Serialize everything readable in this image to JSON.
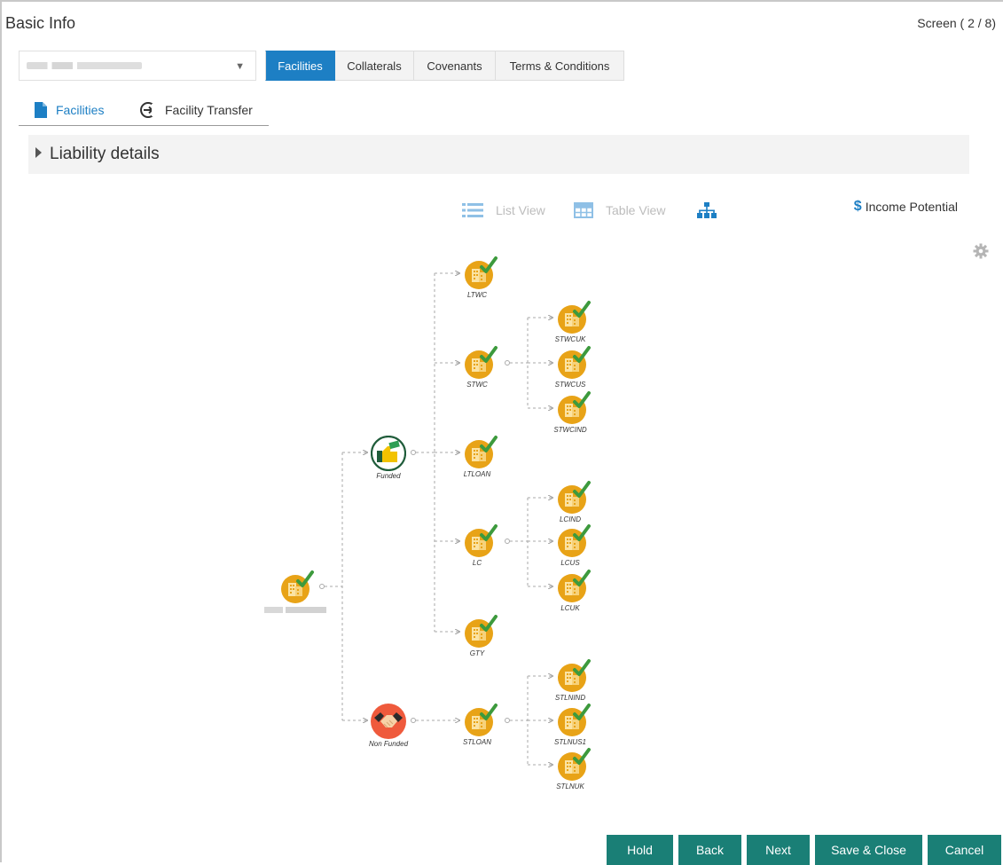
{
  "header": {
    "title": "Basic Info",
    "screen": "Screen ( 2 / 8)"
  },
  "main_tabs": [
    {
      "label": "Facilities",
      "active": true
    },
    {
      "label": "Collaterals",
      "active": false
    },
    {
      "label": "Covenants",
      "active": false
    },
    {
      "label": "Terms & Conditions",
      "active": false
    }
  ],
  "sub_tabs": [
    {
      "label": "Facilities",
      "icon": "document-icon",
      "active": true
    },
    {
      "label": "Facility Transfer",
      "icon": "transfer-arrow-icon",
      "active": false
    }
  ],
  "accordion": {
    "label": "Liability details",
    "expanded": false
  },
  "views": {
    "list": "List View",
    "table": "Table View",
    "hierarchy_icon": "org-chart-icon"
  },
  "income_potential": "Income Potential",
  "tree_nodes": {
    "root": "",
    "funded": "Funded",
    "nonfunded": "Non Funded",
    "ltwc": "LTWC",
    "stwc": "STWC",
    "ltloan": "LTLOAN",
    "lc": "LC",
    "gty": "GTY",
    "stloan": "STLOAN",
    "stwcuk": "STWCUK",
    "stwcus": "STWCUS",
    "stwcind": "STWCIND",
    "lcind": "LCIND",
    "lcus": "LCUS",
    "lcuk": "LCUK",
    "stlnind": "STLNIND",
    "stlnus1": "STLNUS1",
    "stlnuk": "STLNUK"
  },
  "buttons": {
    "hold": "Hold",
    "back": "Back",
    "next": "Next",
    "save_close": "Save & Close",
    "cancel": "Cancel"
  },
  "colors": {
    "accent": "#1d7fc4",
    "button": "#1a7f76",
    "node": "#e8a317",
    "check": "#3d9a3d",
    "nonfunded": "#ef5a3c"
  }
}
